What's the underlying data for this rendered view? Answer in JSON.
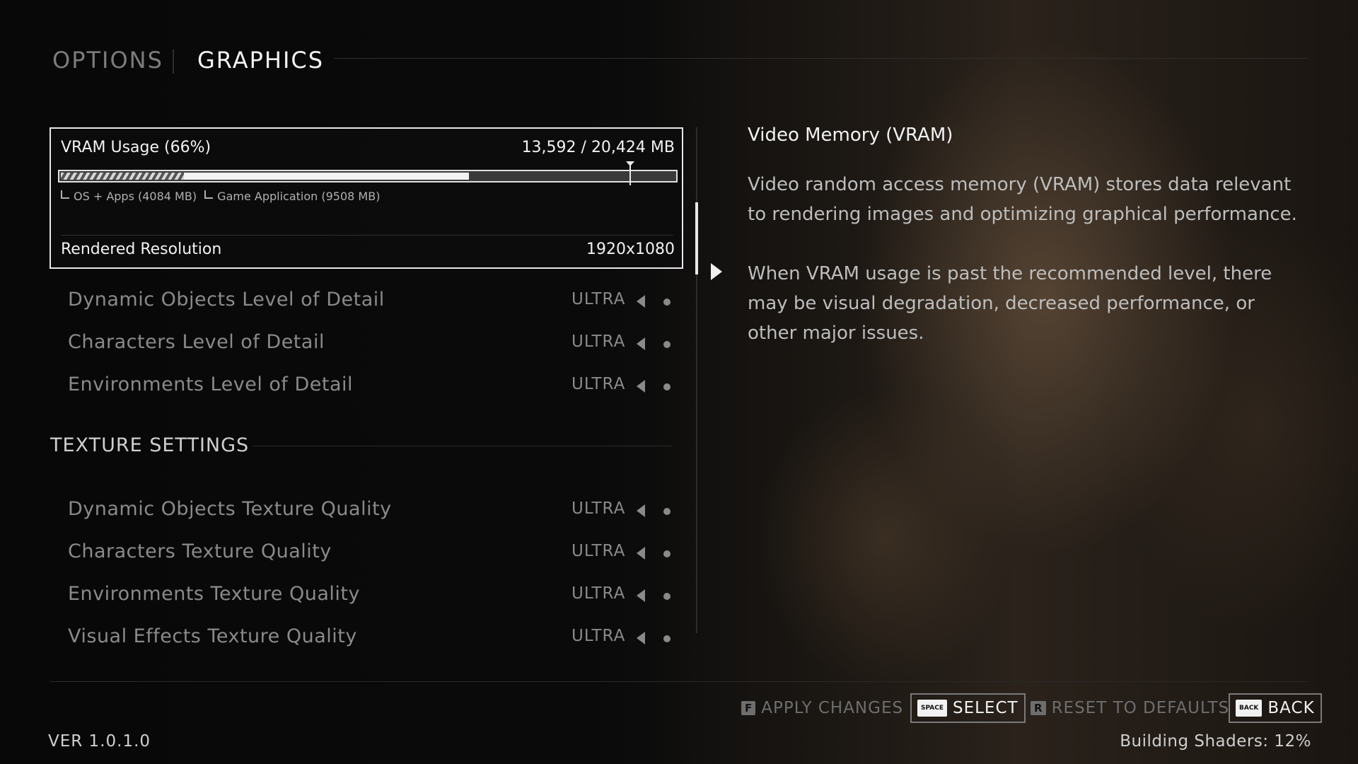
{
  "header": {
    "tab_options": "OPTIONS",
    "tab_graphics": "GRAPHICS"
  },
  "vram": {
    "label": "VRAM Usage (66%)",
    "value": "13,592 / 20,424 MB",
    "os_fraction": 0.2,
    "game_fraction": 0.465,
    "recommended_fraction": 0.927,
    "legend_os": "OS + Apps (4084 MB)",
    "legend_game": "Game Application (9508 MB)",
    "resolution_label": "Rendered Resolution",
    "resolution_value": "1920x1080"
  },
  "lod_rows": [
    {
      "label": "Dynamic Objects Level of Detail",
      "value": "ULTRA"
    },
    {
      "label": "Characters Level of Detail",
      "value": "ULTRA"
    },
    {
      "label": "Environments Level of Detail",
      "value": "ULTRA"
    }
  ],
  "texture_section": {
    "title": "TEXTURE SETTINGS",
    "rows": [
      {
        "label": "Dynamic Objects Texture Quality",
        "value": "ULTRA"
      },
      {
        "label": "Characters Texture Quality",
        "value": "ULTRA"
      },
      {
        "label": "Environments Texture Quality",
        "value": "ULTRA"
      },
      {
        "label": "Visual Effects Texture Quality",
        "value": "ULTRA"
      }
    ]
  },
  "description": {
    "title": "Video Memory (VRAM)",
    "paragraph1": "Video random access memory (VRAM) stores data relevant to rendering images and optimizing graphical performance.",
    "paragraph2": "When VRAM usage is past the recommended level, there may be visual degradation, decreased performance, or other major issues."
  },
  "footer": {
    "apply_key": "F",
    "apply_label": "APPLY CHANGES",
    "select_key": "SPACE",
    "select_label": "SELECT",
    "reset_key": "R",
    "reset_label": "RESET TO DEFAULTS",
    "back_key": "BACK",
    "back_label": "BACK",
    "version": "VER 1.0.1.0",
    "status": "Building Shaders: 12%"
  }
}
